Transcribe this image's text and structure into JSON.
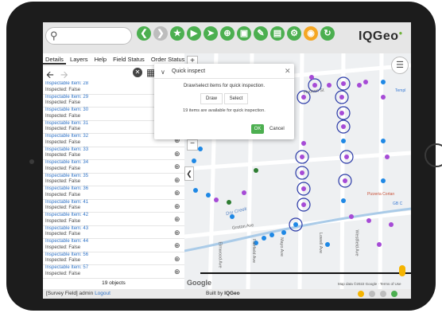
{
  "search": {
    "placeholder": ""
  },
  "toolbar": {
    "icons": [
      "back-icon",
      "forward-icon",
      "favorite-icon",
      "play-icon",
      "navigate-icon",
      "zoom-search-icon",
      "screenshot-icon",
      "edit-icon",
      "report-icon",
      "settings-icon",
      "survey-icon",
      "map-sync-icon"
    ]
  },
  "brand": {
    "logo": "IQGeo"
  },
  "tabs": [
    "Details",
    "Layers",
    "Help",
    "Field Status",
    "Order Status"
  ],
  "items": [
    {
      "title": "Inspectable Item: 28",
      "status": "Inspected: False"
    },
    {
      "title": "Inspectable Item: 29",
      "status": "Inspected: False"
    },
    {
      "title": "Inspectable Item: 30",
      "status": "Inspected: False"
    },
    {
      "title": "Inspectable Item: 31",
      "status": "Inspected: False"
    },
    {
      "title": "Inspectable Item: 32",
      "status": "Inspected: False"
    },
    {
      "title": "Inspectable Item: 33",
      "status": "Inspected: False"
    },
    {
      "title": "Inspectable Item: 34",
      "status": "Inspected: False"
    },
    {
      "title": "Inspectable Item: 35",
      "status": "Inspected: False"
    },
    {
      "title": "Inspectable Item: 36",
      "status": "Inspected: False"
    },
    {
      "title": "Inspectable Item: 41",
      "status": "Inspected: False"
    },
    {
      "title": "Inspectable Item: 42",
      "status": "Inspected: False"
    },
    {
      "title": "Inspectable Item: 43",
      "status": "Inspected: False"
    },
    {
      "title": "Inspectable Item: 44",
      "status": "Inspected: False"
    },
    {
      "title": "Inspectable Item: 56",
      "status": "Inspected: False"
    },
    {
      "title": "Inspectable Item: 57",
      "status": "Inspected: False"
    }
  ],
  "panel": {
    "count": "19 objects"
  },
  "footer": {
    "user": "[Survey Field] admin",
    "logout": "Logout",
    "built": "Built by",
    "built_brand": "IQGeo"
  },
  "dialog": {
    "title": "Quick inspect",
    "instruction": "Draw/select items for quick inspection.",
    "draw": "Draw",
    "select": "Select",
    "available": "19 items are available for quick inspection.",
    "ok": "OK",
    "cancel": "Cancel"
  },
  "map": {
    "google": "Google",
    "attribution": "Map data ©2022 Google · Terms of Use",
    "streets": [
      "Dry Creek",
      "Groton Ave",
      "Elmwood Ave",
      "Fairfield Ave",
      "Mayo Ave",
      "Lowell Ave",
      "Westfield Ave",
      "Hudson St"
    ],
    "poi": [
      "Pizzeria Cortan",
      "Templ",
      "GB C"
    ]
  },
  "colors": {
    "accent": "#4caf50",
    "link": "#2e72c6",
    "purple": "#a64bd6",
    "blue": "#1e88e5"
  }
}
